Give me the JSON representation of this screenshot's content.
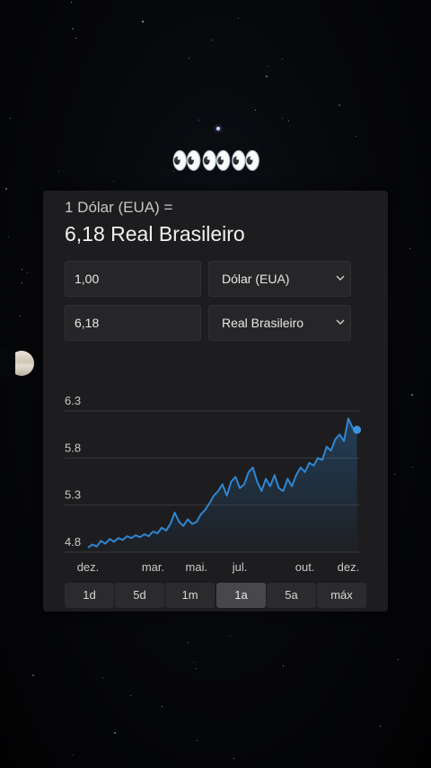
{
  "decoration": {
    "eyes": "👀👀👀"
  },
  "converter": {
    "equals_label": "1 Dólar (EUA) =",
    "result_label": "6,18 Real Brasileiro",
    "from_amount": "1,00",
    "from_currency": "Dólar (EUA)",
    "to_amount": "6,18",
    "to_currency": "Real Brasileiro"
  },
  "range_buttons": [
    "1d",
    "5d",
    "1m",
    "1a",
    "5a",
    "máx"
  ],
  "selected_range": "1a",
  "colors": {
    "line": "#2f86d3",
    "card": "#1d1d1f",
    "active_button": "#48484b"
  },
  "chart_data": {
    "type": "line",
    "title": "",
    "xlabel": "",
    "ylabel": "",
    "ylim": [
      4.8,
      6.3
    ],
    "y_ticks": [
      "6.3",
      "5.8",
      "5.3",
      "4.8"
    ],
    "x_ticks": [
      "dez.",
      "mar.",
      "mai.",
      "jul.",
      "out.",
      "dez."
    ],
    "x_tick_positions": [
      0,
      3,
      5,
      7,
      10,
      12
    ],
    "grid": true,
    "series": [
      {
        "x": [
          0,
          0.2,
          0.4,
          0.6,
          0.8,
          1.0,
          1.2,
          1.4,
          1.6,
          1.8,
          2.0,
          2.2,
          2.4,
          2.6,
          2.8,
          3.0,
          3.2,
          3.4,
          3.6,
          3.8,
          4.0,
          4.2,
          4.4,
          4.6,
          4.8,
          5.0,
          5.2,
          5.4,
          5.6,
          5.8,
          6.0,
          6.2,
          6.4,
          6.6,
          6.8,
          7.0,
          7.2,
          7.4,
          7.6,
          7.8,
          8.0,
          8.2,
          8.4,
          8.6,
          8.8,
          9.0,
          9.2,
          9.4,
          9.6,
          9.8,
          10.0,
          10.2,
          10.4,
          10.6,
          10.8,
          11.0,
          11.2,
          11.4,
          11.6,
          11.8,
          12.0,
          12.2,
          12.4
        ],
        "values": [
          4.85,
          4.88,
          4.86,
          4.92,
          4.89,
          4.94,
          4.91,
          4.95,
          4.93,
          4.97,
          4.95,
          4.98,
          4.96,
          4.99,
          4.97,
          5.02,
          5.0,
          5.06,
          5.03,
          5.1,
          5.22,
          5.12,
          5.08,
          5.15,
          5.1,
          5.12,
          5.2,
          5.25,
          5.32,
          5.4,
          5.45,
          5.52,
          5.4,
          5.55,
          5.6,
          5.48,
          5.52,
          5.65,
          5.7,
          5.55,
          5.45,
          5.58,
          5.5,
          5.62,
          5.48,
          5.45,
          5.58,
          5.5,
          5.62,
          5.7,
          5.65,
          5.75,
          5.72,
          5.8,
          5.78,
          5.92,
          5.88,
          6.0,
          6.05,
          5.98,
          6.22,
          6.12,
          6.1
        ]
      }
    ]
  }
}
